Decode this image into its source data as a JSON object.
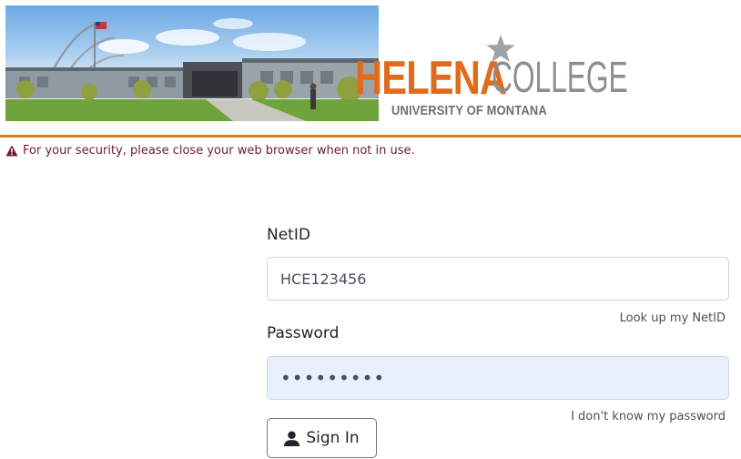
{
  "header": {
    "logo": {
      "name_primary": "HELENA",
      "name_secondary": "COLLEGE",
      "affiliation": "UNIVERSITY OF MONTANA"
    },
    "accent_color": "#e07a1f"
  },
  "alert": {
    "icon": "warning-icon",
    "text": "For your security, please close your web browser when not in use."
  },
  "login": {
    "netid_label": "NetID",
    "netid_value": "HCE123456",
    "lookup_link": "Look up my NetID",
    "password_label": "Password",
    "password_value": "•••••••••",
    "forgot_link": "I don't know my password",
    "signin_label": "Sign In",
    "signin_icon": "user-icon"
  }
}
